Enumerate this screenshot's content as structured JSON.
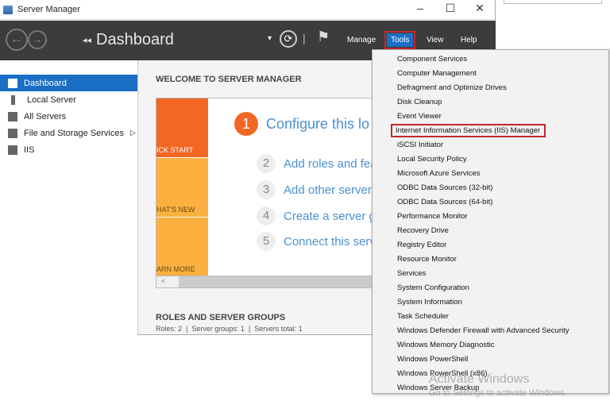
{
  "window": {
    "title": "Server Manager",
    "minimize": "–",
    "maximize": "☐",
    "close": "✕"
  },
  "header": {
    "back": "←",
    "forward": "→",
    "title": "Dashboard",
    "breadcrumb_arrow": "◂◂",
    "dropdown": "▾",
    "refresh": "⟳",
    "separator": "|",
    "flag": "⚑",
    "menu": {
      "manage": "Manage",
      "tools": "Tools",
      "view": "View",
      "help": "Help"
    }
  },
  "sidebar": {
    "items": [
      {
        "label": "Dashboard"
      },
      {
        "label": "Local Server"
      },
      {
        "label": "All Servers"
      },
      {
        "label": "File and Storage Services",
        "arrow": "▷"
      },
      {
        "label": "IIS"
      }
    ]
  },
  "main": {
    "welcome": "WELCOME TO SERVER MANAGER",
    "tiles": [
      "ICK START",
      "HAT'S NEW",
      "ARN MORE"
    ],
    "steps": [
      {
        "n": "1",
        "label": "Configure this lo"
      },
      {
        "n": "2",
        "label": "Add roles and fea"
      },
      {
        "n": "3",
        "label": "Add other servers"
      },
      {
        "n": "4",
        "label": "Create a server g"
      },
      {
        "n": "5",
        "label": "Connect this serv"
      }
    ],
    "scroll_left": "<",
    "roles_title": "ROLES AND SERVER GROUPS",
    "roles_summary": "Roles: 2  |  Server groups: 1  |  Servers total: 1"
  },
  "tools_menu": [
    "Component Services",
    "Computer Management",
    "Defragment and Optimize Drives",
    "Disk Cleanup",
    "Event Viewer",
    "Internet Information Services (IIS) Manager",
    "iSCSI Initiator",
    "Local Security Policy",
    "Microsoft Azure Services",
    "ODBC Data Sources (32-bit)",
    "ODBC Data Sources (64-bit)",
    "Performance Monitor",
    "Recovery Drive",
    "Registry Editor",
    "Resource Monitor",
    "Services",
    "System Configuration",
    "System Information",
    "Task Scheduler",
    "Windows Defender Firewall with Advanced Security",
    "Windows Memory Diagnostic",
    "Windows PowerShell",
    "Windows PowerShell (x86)",
    "Windows Server Backup"
  ],
  "watermark": {
    "title": "Activate Windows",
    "subtitle": "Go to Settings to activate Windows."
  }
}
